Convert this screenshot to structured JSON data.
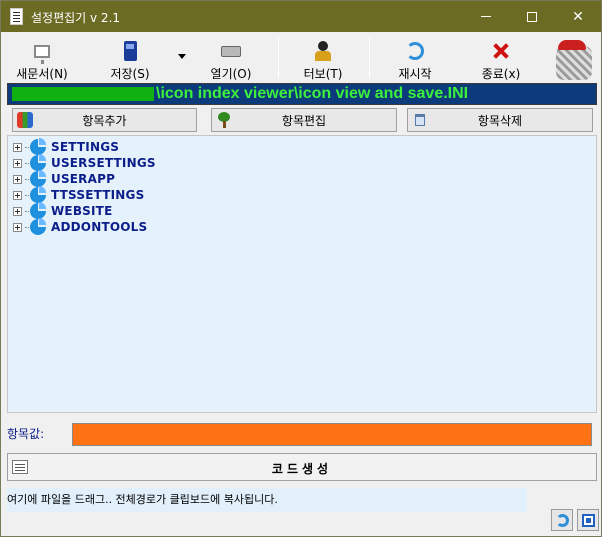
{
  "window": {
    "title": "설정편집기 v 2.1"
  },
  "toolbar": {
    "new_label": "새문서(N)",
    "save_label": "저장(S)",
    "open_label": "열기(O)",
    "turbo_label": "터보(T)",
    "restart_label": "재시작",
    "exit_label": "종료(x)"
  },
  "path": {
    "text": "\\icon index viewer\\icon view and save.INI"
  },
  "item_buttons": {
    "add_label": "항목추가",
    "edit_label": "항목편집",
    "delete_label": "항목삭제"
  },
  "tree": {
    "items": [
      {
        "label": "SETTINGS"
      },
      {
        "label": "USERSETTINGS"
      },
      {
        "label": "USERAPP"
      },
      {
        "label": "TTSSETTINGS"
      },
      {
        "label": "WEBSITE"
      },
      {
        "label": "ADDONTOOLS"
      }
    ]
  },
  "value": {
    "label": "항목값:",
    "current": ""
  },
  "generate": {
    "label": "코드생성"
  },
  "status": {
    "drop_hint": "여기에 파일을 드래그.. 전체경로가 클립보드에 복사됩니다."
  },
  "colors": {
    "titlebar": "#6b6b24",
    "path_background": "#0d3a7a",
    "path_text": "#3cf03c",
    "value_background": "#ff7214",
    "tree_background": "#e6f2fb",
    "tree_label": "#0c1e8a"
  },
  "icons": {
    "new": "monitor-icon",
    "save": "floppy-icon",
    "open": "drive-icon",
    "turbo": "turbo-icon",
    "restart": "refresh-icon",
    "exit": "close-x-icon"
  }
}
